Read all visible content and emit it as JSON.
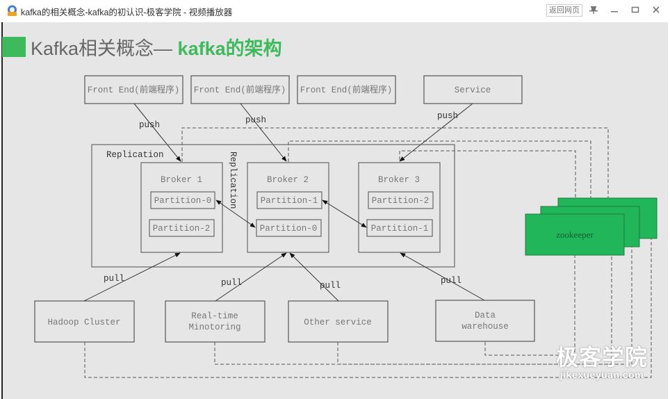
{
  "window": {
    "title": "kafka的相关概念-kafka的初认识-极客学院 - 视频播放器",
    "back_button": "返回网页",
    "controls": {
      "pin": "pin-icon",
      "minimize": "minimize-icon",
      "maximize": "maximize-icon",
      "close": "close-icon"
    }
  },
  "slide": {
    "title_prefix": "Kafka相关概念— ",
    "title_accent": "kafka的架构",
    "accent_color": "#3dba5c"
  },
  "diagram": {
    "producers": [
      {
        "label": "Front End(前端程序)",
        "edge": "push"
      },
      {
        "label": "Front End(前端程序)",
        "edge": "push"
      },
      {
        "label": "Front End(前端程序)"
      },
      {
        "label": "Service",
        "edge": "push"
      }
    ],
    "cluster_label": "Replication",
    "replication_vertical_label": "Replication",
    "brokers": [
      {
        "label": "Broker 1",
        "partitions": [
          "Partition-0",
          "Partition-2"
        ]
      },
      {
        "label": "Broker 2",
        "partitions": [
          "Partition-1",
          "Partition-0"
        ]
      },
      {
        "label": "Broker 3",
        "partitions": [
          "Partition-2",
          "Partition-1"
        ]
      }
    ],
    "zookeeper_label": "zookeeper",
    "zookeeper_color": "#21b65a",
    "consumers": [
      {
        "label": [
          "Hadoop Cluster"
        ],
        "edge": "pull"
      },
      {
        "label": [
          "Real-time",
          "Minotoring"
        ],
        "edge": "pull"
      },
      {
        "label": [
          "Other service"
        ],
        "edge": "pull"
      },
      {
        "label": [
          "Data",
          "warehouse"
        ],
        "edge": "pull"
      }
    ]
  },
  "watermark": {
    "cn": "极客学院",
    "en": "jikexueyuan.com"
  }
}
